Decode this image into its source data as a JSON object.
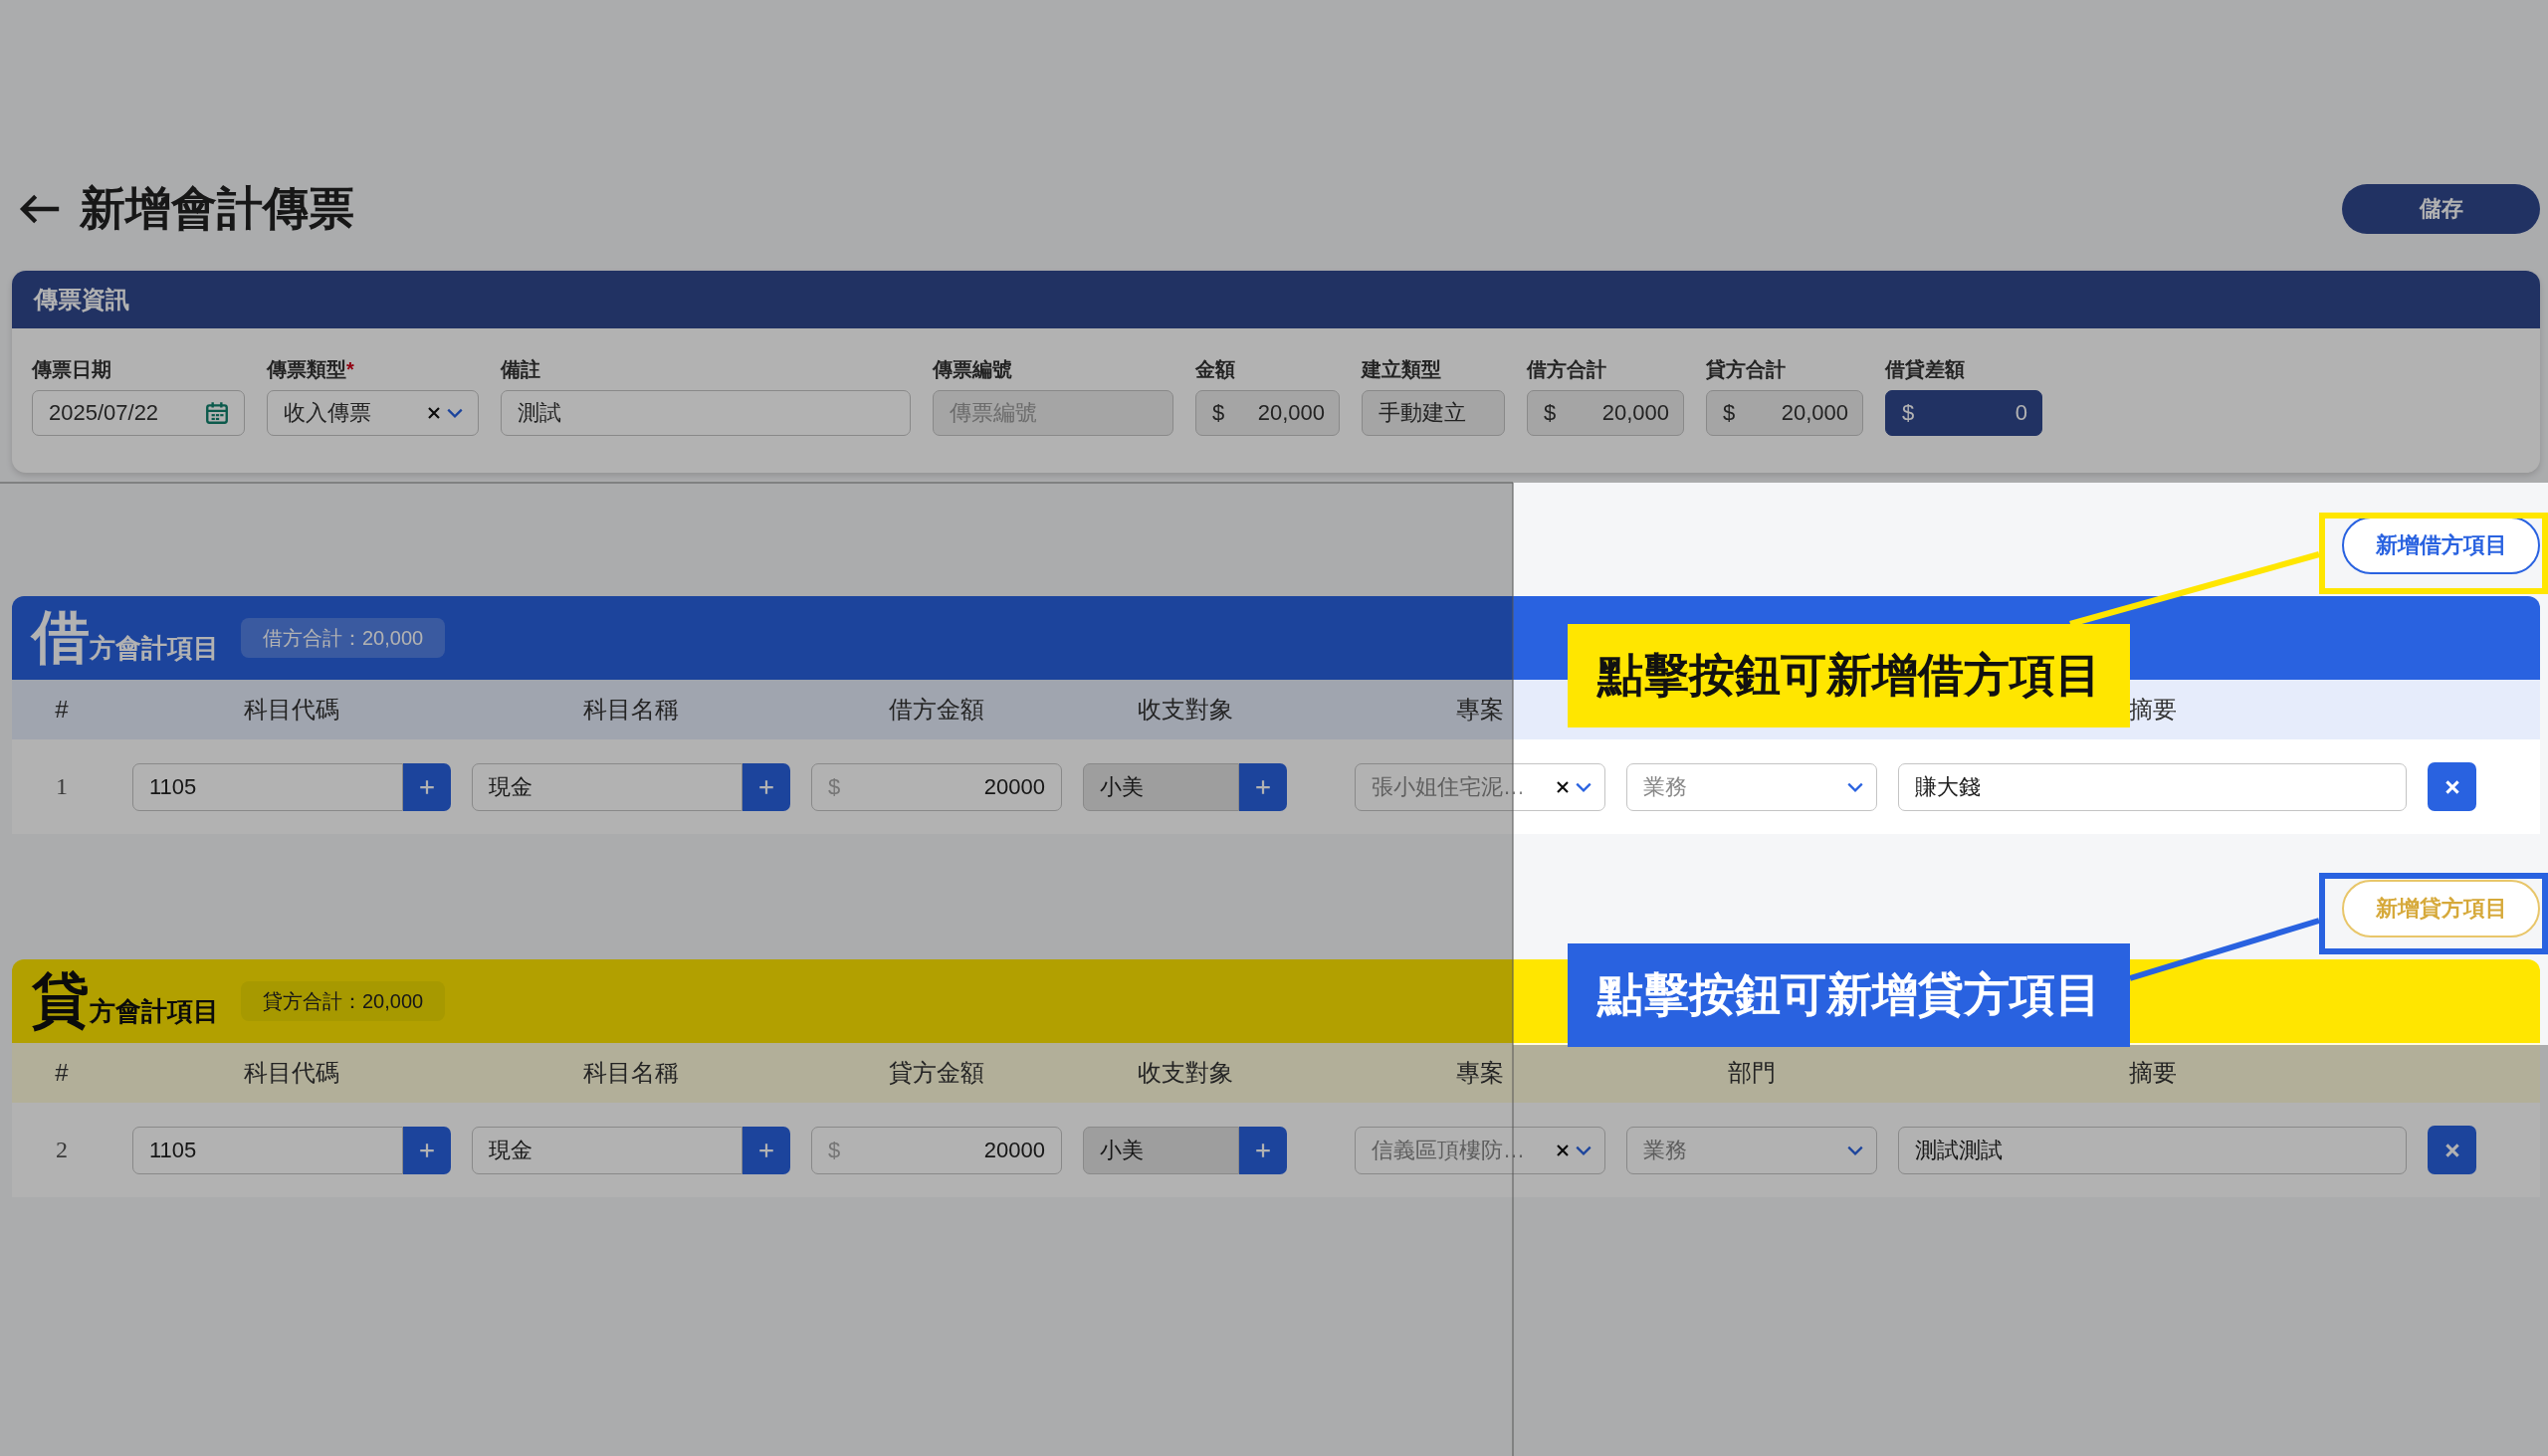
{
  "page": {
    "title": "新增會計傳票",
    "save_button": "儲存"
  },
  "voucher_info": {
    "title": "傳票資訊",
    "fields": [
      {
        "label": "傳票日期",
        "kind": "date",
        "value": "2025/07/22",
        "disabled": false
      },
      {
        "label": "傳票類型",
        "required_mark": "*",
        "kind": "select",
        "value": "收入傳票",
        "disabled": false
      },
      {
        "label": "備註",
        "kind": "text",
        "value": "測試",
        "disabled": false
      },
      {
        "label": "傳票編號",
        "kind": "text",
        "placeholder": "傳票編號",
        "disabled": true
      },
      {
        "label": "金額",
        "kind": "money",
        "currency": "$",
        "value": "20,000",
        "disabled": true
      },
      {
        "label": "建立類型",
        "kind": "text",
        "value": "手動建立",
        "disabled": true
      },
      {
        "label": "借方合計",
        "kind": "money",
        "currency": "$",
        "value": "20,000",
        "disabled": true
      },
      {
        "label": "貸方合計",
        "kind": "money",
        "currency": "$",
        "value": "20,000",
        "disabled": true
      },
      {
        "label": "借貸差額",
        "kind": "difference",
        "currency": "$",
        "value": "0"
      }
    ]
  },
  "sections": [
    {
      "kind": "debit",
      "add_button": "新增借方項目",
      "big_char": "借",
      "title": "方會計項目",
      "total_badge": "借方合計：20,000",
      "columns": {
        "number": "#",
        "code": "科目代碼",
        "name": "科目名稱",
        "amount": "借方金額",
        "party": "收支對象",
        "project": "專案",
        "summary": "摘要"
      },
      "rows": [
        {
          "number": "1",
          "code": "1105",
          "name": "現金",
          "currency": "$",
          "amount": "20000",
          "party": "小美",
          "project": "張小姐住宅泥…",
          "department": "業務",
          "summary": "賺大錢"
        }
      ]
    },
    {
      "kind": "credit",
      "add_button": "新增貸方項目",
      "big_char": "貸",
      "title": "方會計項目",
      "total_badge": "貸方合計：20,000",
      "columns": {
        "number": "#",
        "code": "科目代碼",
        "name": "科目名稱",
        "amount": "貸方金額",
        "party": "收支對象",
        "project": "專案",
        "department": "部門",
        "summary": "摘要"
      },
      "rows": [
        {
          "number": "2",
          "code": "1105",
          "name": "現金",
          "currency": "$",
          "amount": "20000",
          "party": "小美",
          "project": "信義區頂樓防…",
          "department": "業務",
          "summary": "測試測試"
        }
      ]
    }
  ],
  "callouts": [
    {
      "text": "點擊按鈕可新增借方項目",
      "color": "#ffe600"
    },
    {
      "text": "點擊按鈕可新增貸方項目",
      "color": "#2962e0"
    }
  ]
}
